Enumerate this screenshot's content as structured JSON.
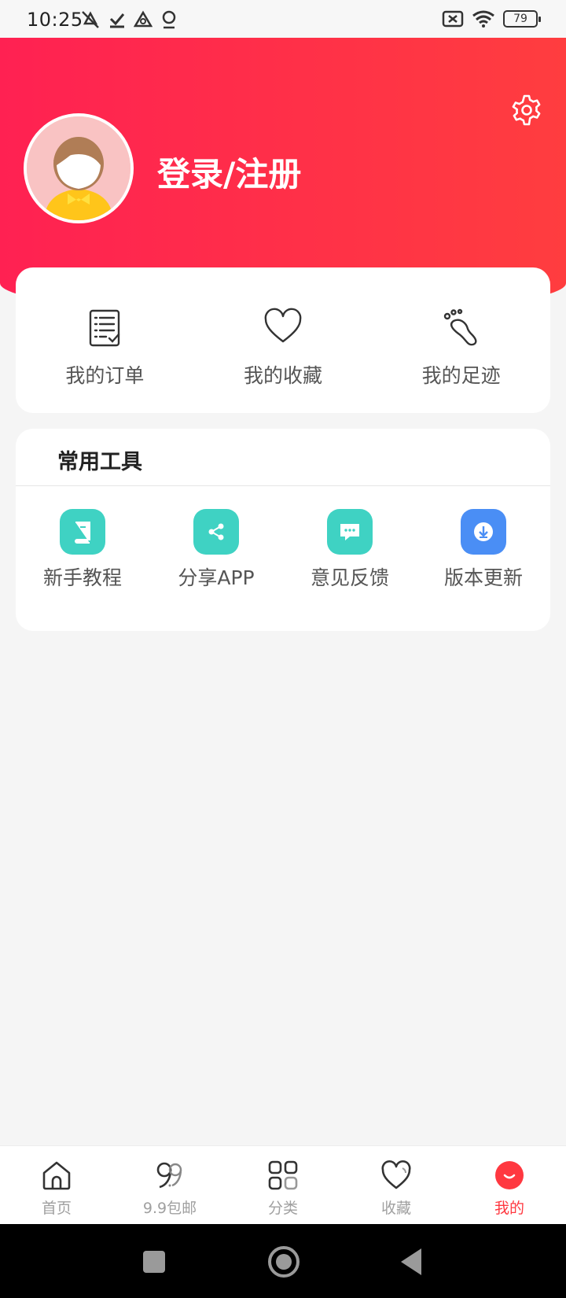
{
  "status_bar": {
    "time": "10:25",
    "battery": "79"
  },
  "header": {
    "login_label": "登录/注册"
  },
  "quick_actions": [
    {
      "label": "我的订单",
      "icon": "order-list-icon"
    },
    {
      "label": "我的收藏",
      "icon": "heart-icon"
    },
    {
      "label": "我的足迹",
      "icon": "footprint-icon"
    }
  ],
  "tools": {
    "title": "常用工具",
    "items": [
      {
        "label": "新手教程",
        "icon": "book-icon",
        "color": "#3fd2c3"
      },
      {
        "label": "分享APP",
        "icon": "share-icon",
        "color": "#3fd2c3"
      },
      {
        "label": "意见反馈",
        "icon": "chat-icon",
        "color": "#3fd2c3"
      },
      {
        "label": "版本更新",
        "icon": "download-icon",
        "color": "#4a8ef5"
      }
    ]
  },
  "tabbar": {
    "items": [
      {
        "label": "首页",
        "icon": "home-icon"
      },
      {
        "label": "9.9包邮",
        "icon": "nine-nine-icon"
      },
      {
        "label": "分类",
        "icon": "grid-icon"
      },
      {
        "label": "收藏",
        "icon": "heart-icon"
      },
      {
        "label": "我的",
        "icon": "smile-icon"
      }
    ],
    "active_color": "#ff3840"
  },
  "theme": {
    "gradient_start": "#ff2152",
    "gradient_end": "#ff3d3f"
  }
}
